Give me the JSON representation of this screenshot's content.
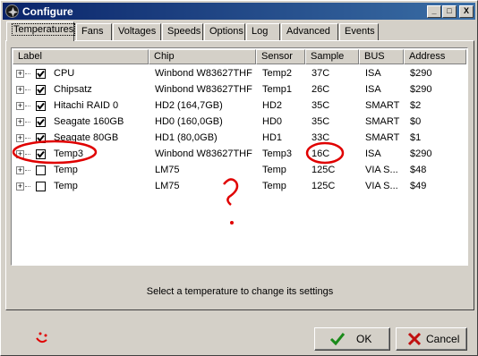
{
  "window": {
    "title": "Configure",
    "title_bar_color": "#0a246a"
  },
  "title_buttons": {
    "minimize": "_",
    "maximize": "□",
    "close": "X"
  },
  "tabs": [
    {
      "label": "Temperatures",
      "active": true
    },
    {
      "label": "Fans"
    },
    {
      "label": "Voltages"
    },
    {
      "label": "Speeds"
    },
    {
      "label": "Options"
    },
    {
      "label": "Log"
    },
    {
      "label": "Advanced"
    },
    {
      "label": "Events"
    }
  ],
  "table": {
    "columns": [
      "Label",
      "Chip",
      "Sensor",
      "Sample",
      "BUS",
      "Address"
    ],
    "rows": [
      {
        "checked": true,
        "label": "CPU",
        "chip": "Winbond W83627THF",
        "sensor": "Temp2",
        "sample": "37C",
        "bus": "ISA",
        "address": "$290"
      },
      {
        "checked": true,
        "label": "Chipsatz",
        "chip": "Winbond W83627THF",
        "sensor": "Temp1",
        "sample": "26C",
        "bus": "ISA",
        "address": "$290"
      },
      {
        "checked": true,
        "label": "Hitachi RAID 0",
        "chip": "HD2 (164,7GB)",
        "sensor": "HD2",
        "sample": "35C",
        "bus": "SMART",
        "address": "$2"
      },
      {
        "checked": true,
        "label": "Seagate 160GB",
        "chip": "HD0 (160,0GB)",
        "sensor": "HD0",
        "sample": "35C",
        "bus": "SMART",
        "address": "$0"
      },
      {
        "checked": true,
        "label": "Seagate 80GB",
        "chip": "HD1 (80,0GB)",
        "sensor": "HD1",
        "sample": "33C",
        "bus": "SMART",
        "address": "$1"
      },
      {
        "checked": true,
        "label": "Temp3",
        "chip": "Winbond W83627THF",
        "sensor": "Temp3",
        "sample": "16C",
        "bus": "ISA",
        "address": "$290"
      },
      {
        "checked": false,
        "label": "Temp",
        "chip": "LM75",
        "sensor": "Temp",
        "sample": "125C",
        "bus": "VIA S...",
        "address": "$48"
      },
      {
        "checked": false,
        "label": "Temp",
        "chip": "LM75",
        "sensor": "Temp",
        "sample": "125C",
        "bus": "VIA S...",
        "address": "$49"
      }
    ]
  },
  "status_text": "Select a temperature to change its settings",
  "buttons": {
    "ok": "OK",
    "cancel": "Cancel"
  },
  "annotation": {
    "text": "?",
    "color": "#e00000"
  },
  "colors": {
    "ok_check": "#1a8a1a",
    "cancel_x": "#c01010",
    "annotation_red": "#e00000"
  }
}
